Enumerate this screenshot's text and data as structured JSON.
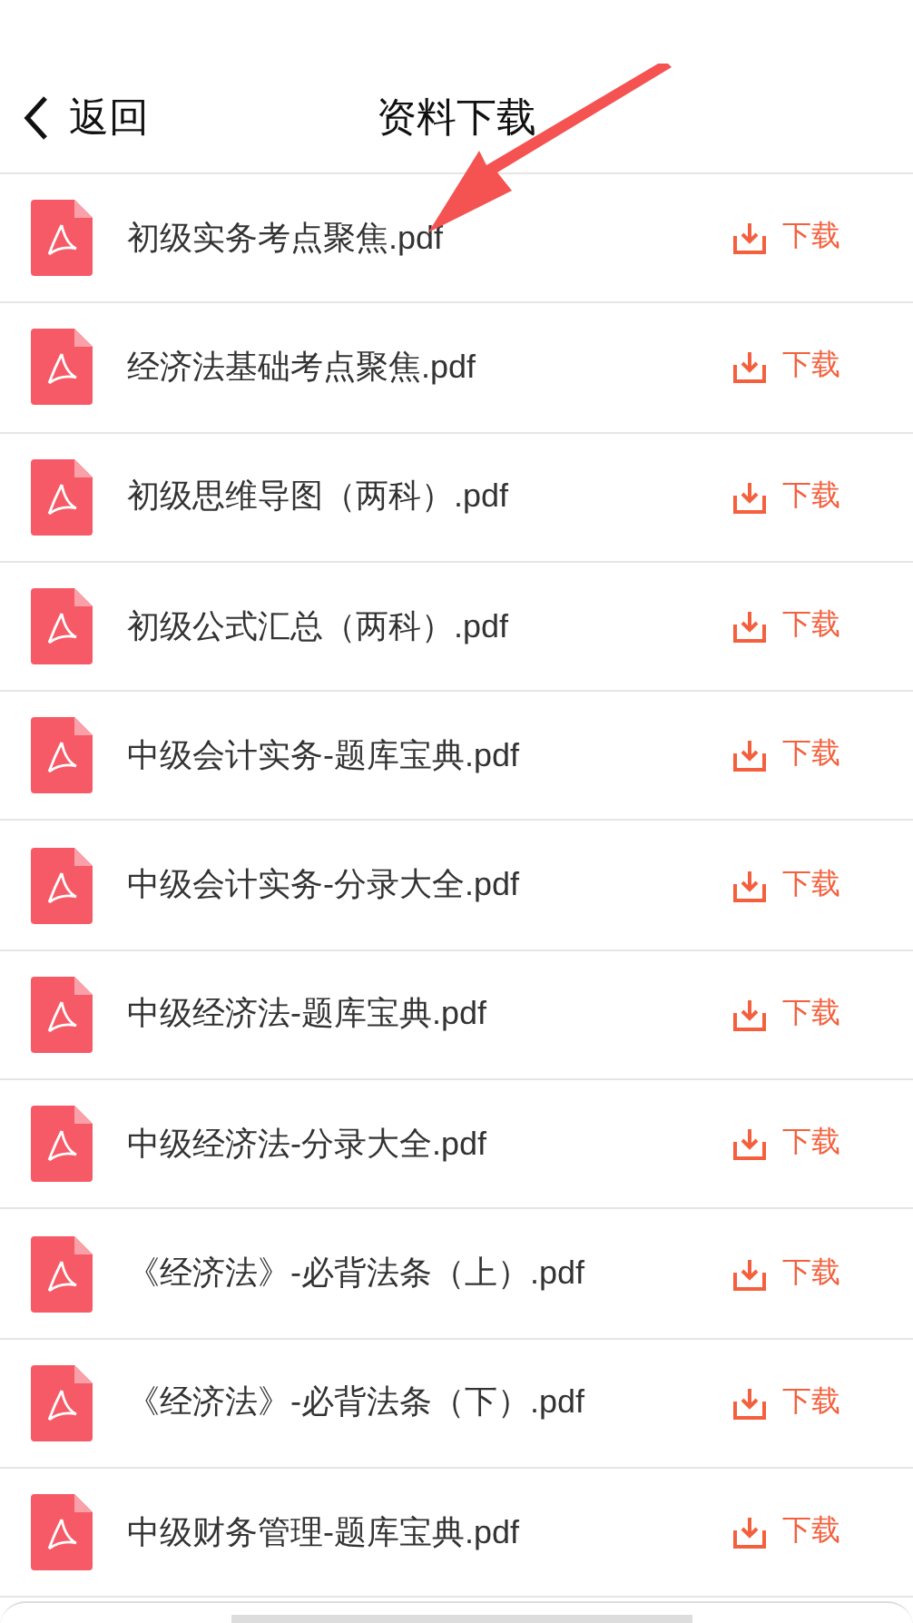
{
  "header": {
    "back_label": "返回",
    "title": "资料下载"
  },
  "files": [
    {
      "name": "初级实务考点聚焦.pdf",
      "action": "下载"
    },
    {
      "name": "经济法基础考点聚焦.pdf",
      "action": "下载"
    },
    {
      "name": "初级思维导图（两科）.pdf",
      "action": "下载"
    },
    {
      "name": "初级公式汇总（两科）.pdf",
      "action": "下载"
    },
    {
      "name": "中级会计实务-题库宝典.pdf",
      "action": "下载"
    },
    {
      "name": "中级会计实务-分录大全.pdf",
      "action": "下载"
    },
    {
      "name": "中级经济法-题库宝典.pdf",
      "action": "下载"
    },
    {
      "name": "中级经济法-分录大全.pdf",
      "action": "下载"
    },
    {
      "name": "《经济法》-必背法条（上）.pdf",
      "action": "下载"
    },
    {
      "name": "《经济法》-必背法条（下）.pdf",
      "action": "下载"
    },
    {
      "name": "中级财务管理-题库宝典.pdf",
      "action": "下载"
    }
  ]
}
